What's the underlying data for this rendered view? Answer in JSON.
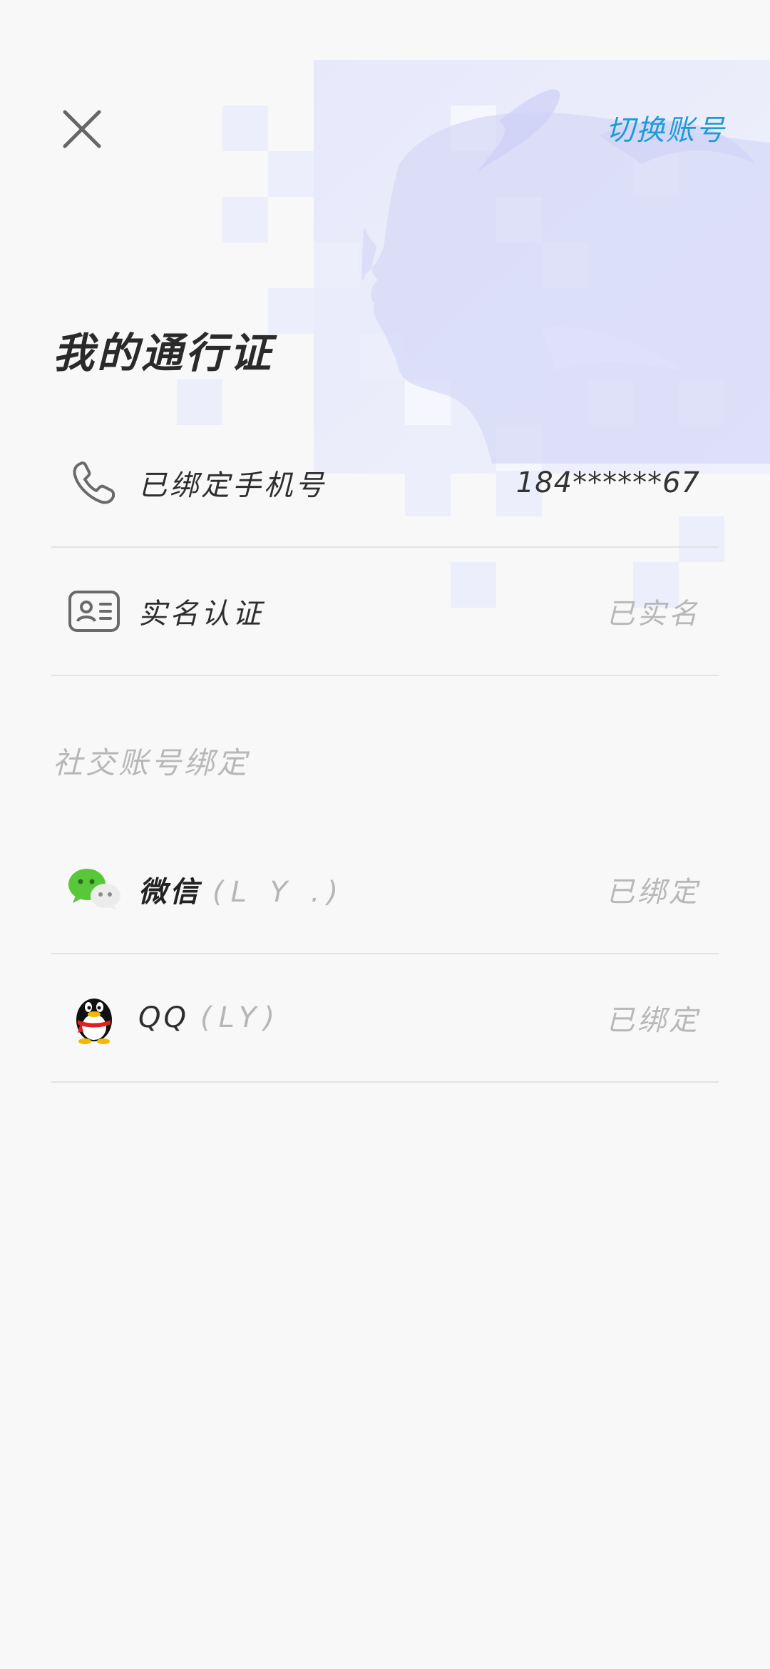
{
  "header": {
    "switch_account_label": "切换账号",
    "title": "我的通行证"
  },
  "account_rows": [
    {
      "icon": "phone-icon",
      "label": "已绑定手机号",
      "value": "184******67"
    },
    {
      "icon": "id-card-icon",
      "label": "实名认证",
      "value": "已实名"
    }
  ],
  "social": {
    "section_title": "社交账号绑定",
    "items": [
      {
        "icon": "wechat-icon",
        "name": "微信",
        "nickname": "(L Y .)",
        "status": "已绑定"
      },
      {
        "icon": "qq-icon",
        "name": "QQ",
        "nickname": "(LY)",
        "status": "已绑定"
      }
    ]
  },
  "colors": {
    "accent": "#1e9bd7",
    "background": "#f8f8f8",
    "muted_text": "#b8b8b8",
    "divider": "#e3e3e3"
  }
}
